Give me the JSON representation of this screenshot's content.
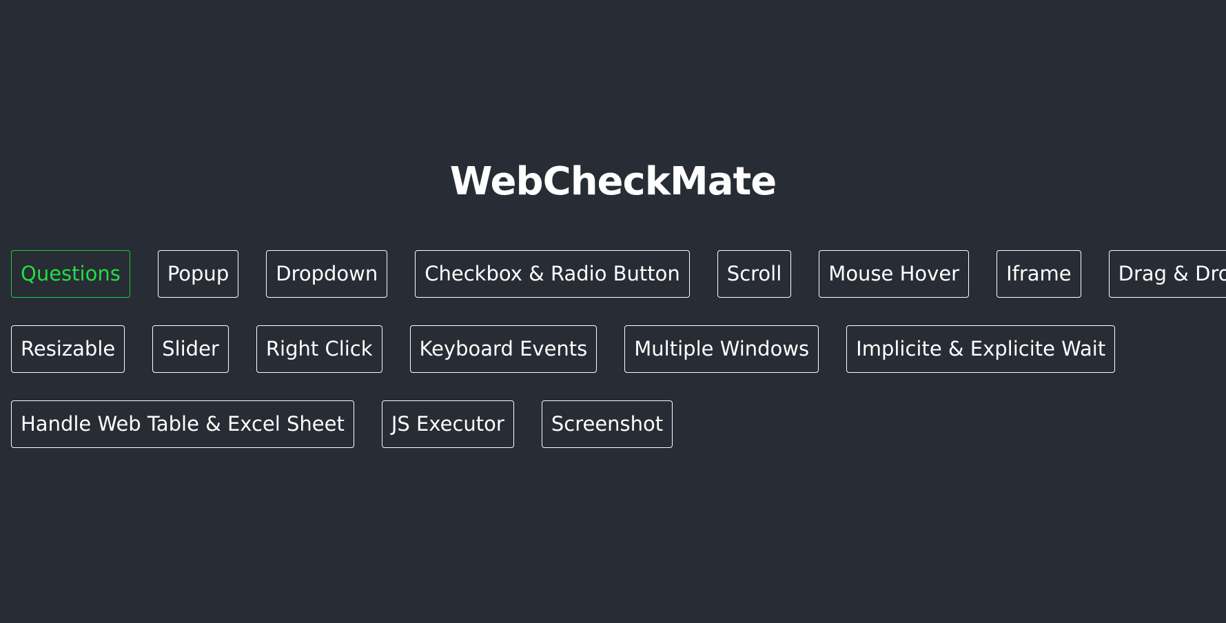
{
  "app": {
    "title": "WebCheckMate",
    "accent_color": "#22dd44",
    "background_color": "#282c34"
  },
  "nav": {
    "rows": [
      [
        {
          "label": "Questions",
          "active": true
        },
        {
          "label": "Popup"
        },
        {
          "label": "Dropdown"
        },
        {
          "label": "Checkbox & Radio Button"
        },
        {
          "label": "Scroll"
        },
        {
          "label": "Mouse Hover"
        },
        {
          "label": "Iframe"
        },
        {
          "label": "Drag & Drop"
        }
      ],
      [
        {
          "label": "Resizable"
        },
        {
          "label": "Slider"
        },
        {
          "label": "Right Click"
        },
        {
          "label": "Keyboard Events"
        },
        {
          "label": "Multiple Windows"
        },
        {
          "label": "Implicite & Explicite Wait"
        }
      ],
      [
        {
          "label": "Handle Web Table & Excel Sheet"
        },
        {
          "label": "JS Executor"
        },
        {
          "label": "Screenshot"
        }
      ]
    ]
  }
}
